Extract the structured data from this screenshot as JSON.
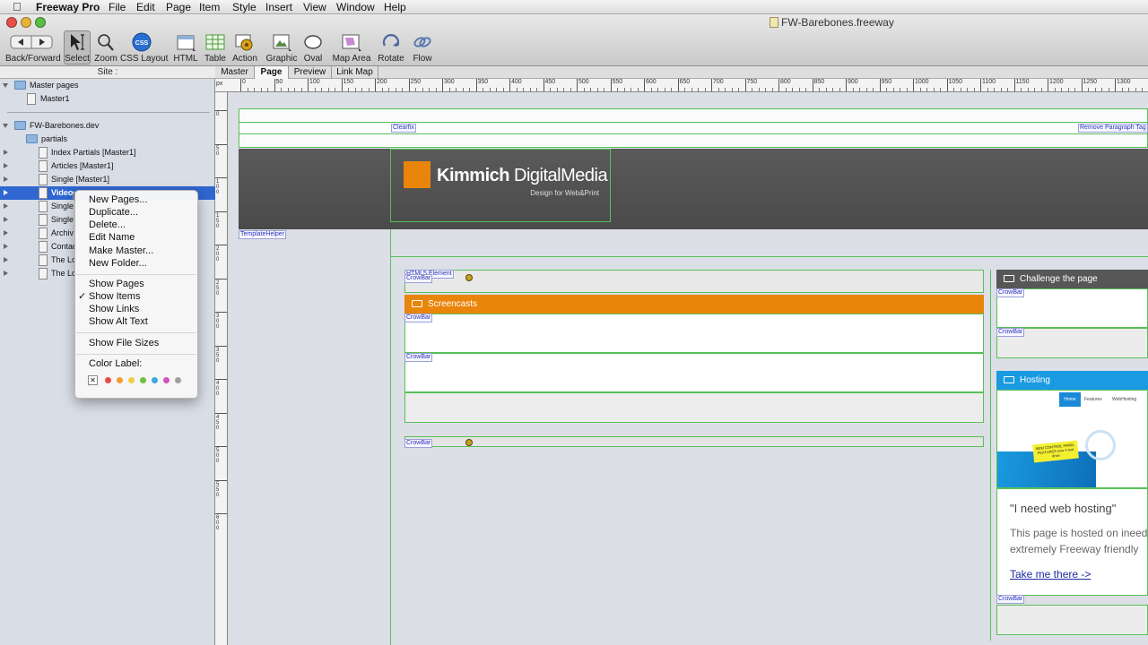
{
  "menubar": {
    "app": "Freeway Pro",
    "items": [
      "File",
      "Edit",
      "Page",
      "Item",
      "Style",
      "Insert",
      "View",
      "Window",
      "Help"
    ]
  },
  "window": {
    "title": "FW-Barebones.freeway"
  },
  "toolbar": {
    "back_forward": "Back/Forward",
    "select": "Select",
    "zoom": "Zoom",
    "css_layout": "CSS Layout",
    "css_badge": "CSS",
    "html": "HTML",
    "table": "Table",
    "action": "Action",
    "graphic": "Graphic",
    "oval": "Oval",
    "map_area": "Map Area",
    "rotate": "Rotate",
    "flow": "Flow"
  },
  "site_header": "Site :",
  "view_tabs": [
    "Master",
    "Page",
    "Preview",
    "Link Map"
  ],
  "sidebar": {
    "master_pages": "Master pages",
    "master1": "Master1",
    "site_root": "FW-Barebones.dev",
    "partials": "partials",
    "items": [
      "Index Partials [Master1]",
      "Articles [Master1]",
      "Single [Master1]",
      "Video",
      "Single",
      "Single",
      "Archiv",
      "Contac",
      "The Lo",
      "The Lo"
    ]
  },
  "context_menu": {
    "items": [
      "New Pages...",
      "Duplicate...",
      "Delete...",
      "Edit Name",
      "Make Master...",
      "New Folder..."
    ],
    "show": [
      "Show Pages",
      "Show Items",
      "Show Links",
      "Show Alt Text"
    ],
    "checked": "Show Items",
    "file_sizes": "Show File Sizes",
    "color_label": "Color Label:",
    "colors": [
      "#e84848",
      "#f0a030",
      "#f0d040",
      "#70c040",
      "#40a8e0",
      "#d850b8",
      "#a0a0a0"
    ]
  },
  "ruler": {
    "unit": "px",
    "marks": [
      "0",
      "50",
      "100",
      "150",
      "200",
      "250",
      "300",
      "350",
      "400",
      "450",
      "500",
      "550",
      "600",
      "650",
      "700",
      "750",
      "800",
      "850",
      "900",
      "950",
      "1000",
      "1050",
      "1100",
      "1150",
      "1200",
      "1250",
      "1300"
    ],
    "v_marks": [
      "0",
      "50",
      "100",
      "150",
      "200",
      "250",
      "300",
      "350",
      "400",
      "450",
      "500",
      "550",
      "600"
    ]
  },
  "page": {
    "clearfix": "Clearfix",
    "remove_paragraph": "Remove Paragraph Tag",
    "logo_bold": "Kimmich",
    "logo_light": " DigitalMedia",
    "logo_sub": "Design for Web&Print",
    "template_helper": "TemplateHelper",
    "html5_element": "HTML5 Element",
    "crowbar": "CrowBar",
    "screencasts": "Screencasts",
    "challenge": "Challenge the page",
    "hosting": "Hosting",
    "hosting_nav": [
      "Home",
      "Features",
      "WebHosting"
    ],
    "hosting_note": "NEW CONTROL PANEL FEATURES now 4 test drive",
    "quote": "\"I need web hosting\"",
    "body_line1": "This page is hosted on ineed",
    "body_line2": "extremely Freeway friendly",
    "link": "Take me there ->",
    "accent_orange": "#e8850a",
    "accent_blue": "#1a9ae0"
  }
}
